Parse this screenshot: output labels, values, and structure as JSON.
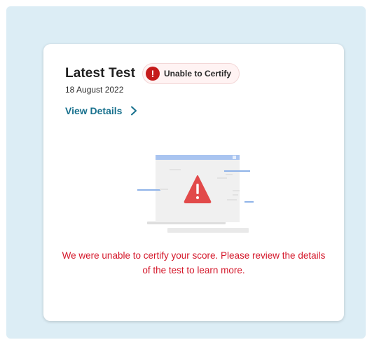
{
  "card": {
    "title": "Latest Test",
    "status_badge": "Unable to Certify",
    "badge_icon": "!",
    "date": "18 August 2022",
    "view_details": "View Details",
    "message": "We were unable to certify your score. Please review the details of the test to learn more."
  },
  "colors": {
    "panel_background": "#dcedf5",
    "card_background": "#ffffff",
    "error_red": "#d4172a",
    "badge_icon_red": "#c51a1a",
    "link_teal": "#17708d",
    "illustration_blue": "#8fb3e8"
  },
  "icons": {
    "badge": "exclamation-circle-icon",
    "link": "chevron-right-icon",
    "illustration": "warning-triangle-icon"
  }
}
